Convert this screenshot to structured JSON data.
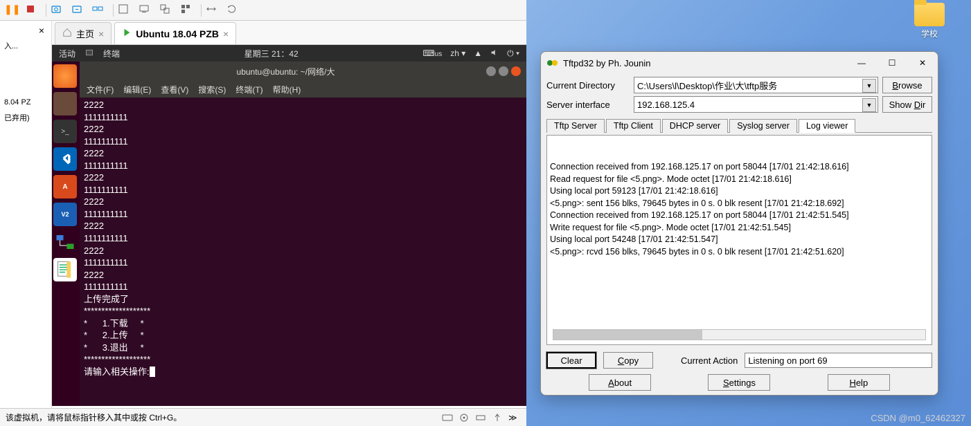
{
  "vmware": {
    "sidebar_input_placeholder": "入...",
    "sidebar_items": [
      "8.04 PZ",
      "已弃用)"
    ],
    "tabs": [
      {
        "icon": "home",
        "label": "主页",
        "close": "×"
      },
      {
        "icon": "play",
        "label": "Ubuntu 18.04 PZB",
        "close": "×"
      }
    ],
    "statusbar_text": "该虚拟机，请将鼠标指针移入其中或按 Ctrl+G。"
  },
  "ubuntu": {
    "topbar_left_1": "活动",
    "topbar_left_2": "终端",
    "topbar_center": "星期三 21：42",
    "topbar_right_kb": "us",
    "topbar_right_lang": "zh",
    "terminal_title": "ubuntu@ubuntu: ~/网络/大",
    "menu_items": [
      "文件(F)",
      "编辑(E)",
      "查看(V)",
      "搜索(S)",
      "终端(T)",
      "帮助(H)"
    ],
    "terminal_lines": [
      "2222",
      "1111111111",
      "2222",
      "1111111111",
      "2222",
      "1111111111",
      "2222",
      "1111111111",
      "2222",
      "1111111111",
      "2222",
      "1111111111",
      "2222",
      "1111111111",
      "2222",
      "1111111111",
      "上传完成了",
      "*******************",
      "*      1.下载     *",
      "*      2.上传     *",
      "*      3.退出     *",
      "*******************",
      "请输入相关操作:"
    ]
  },
  "windows": {
    "folder_label": "学校"
  },
  "tftp": {
    "title": "Tftpd32 by Ph. Jounin",
    "row_dir_label": "Current Directory",
    "row_dir_value": "C:\\Users\\l\\Desktop\\作业\\大\\tftp服务",
    "btn_browse": "Browse",
    "row_if_label": "Server interface",
    "row_if_value": "192.168.125.4",
    "btn_showdir": "Show Dir",
    "tabs": [
      "Tftp Server",
      "Tftp Client",
      "DHCP server",
      "Syslog server",
      "Log viewer"
    ],
    "active_tab_index": 4,
    "log_lines": [
      "Connection received from 192.168.125.17 on port 58044 [17/01 21:42:18.616]",
      "Read request for file <5.png>. Mode octet [17/01 21:42:18.616]",
      "Using local port 59123 [17/01 21:42:18.616]",
      "<5.png>: sent 156 blks, 79645 bytes in 0 s. 0 blk resent [17/01 21:42:18.692]",
      "Connection received from 192.168.125.17 on port 58044 [17/01 21:42:51.545]",
      "Write request for file <5.png>. Mode octet [17/01 21:42:51.545]",
      "Using local port 54248 [17/01 21:42:51.547]",
      "<5.png>: rcvd 156 blks, 79645 bytes in 0 s. 0 blk resent [17/01 21:42:51.620]"
    ],
    "btn_clear": "Clear",
    "btn_copy": "Copy",
    "action_label": "Current Action",
    "action_value": "Listening on port 69",
    "btn_about": "About",
    "btn_settings": "Settings",
    "btn_help": "Help"
  },
  "watermark": "CSDN @m0_62462327"
}
